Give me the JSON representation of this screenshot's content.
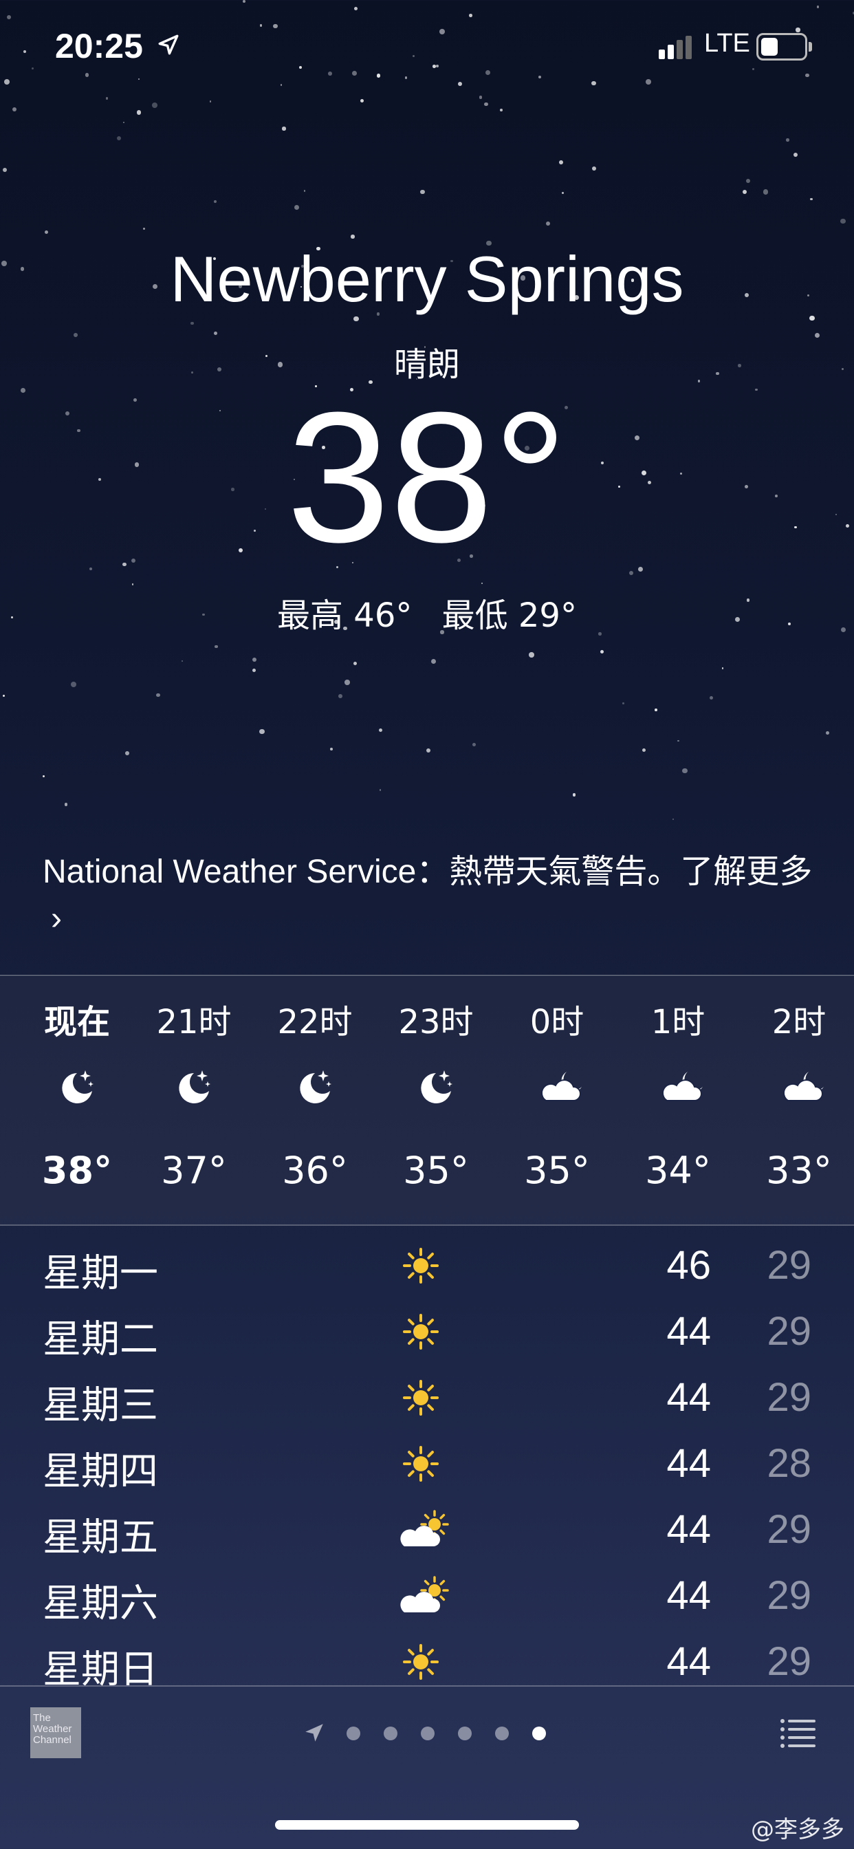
{
  "status_bar": {
    "time": "20:25",
    "network": "LTE"
  },
  "location": {
    "city": "Newberry Springs",
    "condition": "晴朗",
    "temperature": "38°",
    "high": "最高 46°",
    "low": "最低 29°"
  },
  "alert": {
    "text": "National Weather Service：熱帶天氣警告。了解更多",
    "chevron": "›"
  },
  "hourly": [
    {
      "label": "现在",
      "icon": "moon-stars-icon",
      "temp": "38°"
    },
    {
      "label": "21时",
      "icon": "moon-stars-icon",
      "temp": "37°"
    },
    {
      "label": "22时",
      "icon": "moon-stars-icon",
      "temp": "36°"
    },
    {
      "label": "23时",
      "icon": "moon-stars-icon",
      "temp": "35°"
    },
    {
      "label": "0时",
      "icon": "cloud-moon-icon",
      "temp": "35°"
    },
    {
      "label": "1时",
      "icon": "cloud-moon-icon",
      "temp": "34°"
    },
    {
      "label": "2时",
      "icon": "cloud-moon-icon",
      "temp": "33°"
    }
  ],
  "daily": [
    {
      "day": "星期一",
      "icon": "sun-icon",
      "high": "46",
      "low": "29"
    },
    {
      "day": "星期二",
      "icon": "sun-icon",
      "high": "44",
      "low": "29"
    },
    {
      "day": "星期三",
      "icon": "sun-icon",
      "high": "44",
      "low": "29"
    },
    {
      "day": "星期四",
      "icon": "sun-icon",
      "high": "44",
      "low": "28"
    },
    {
      "day": "星期五",
      "icon": "partly-cloudy-icon",
      "high": "44",
      "low": "29"
    },
    {
      "day": "星期六",
      "icon": "partly-cloudy-icon",
      "high": "44",
      "low": "29"
    },
    {
      "day": "星期日",
      "icon": "sun-icon",
      "high": "44",
      "low": "29"
    }
  ],
  "footer": {
    "logo_text": "The Weather Channel",
    "page_count": 6,
    "active_page": 6
  },
  "watermark": "@李多多",
  "colors": {
    "sun": "#f7c531",
    "background_top": "#0b1124",
    "background_bottom": "#2a345a"
  }
}
